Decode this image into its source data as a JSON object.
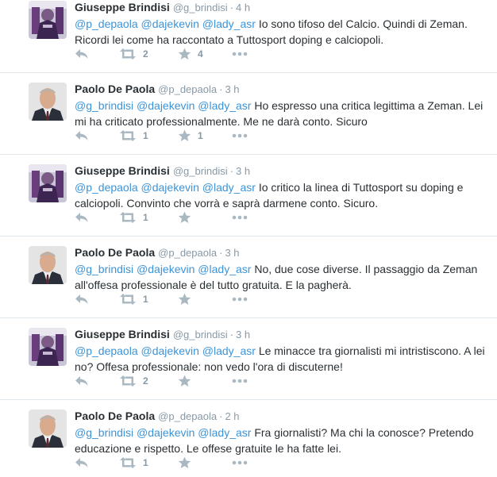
{
  "colors": {
    "mention": "#3b94d9",
    "meta": "#8899a6",
    "text": "#292f33",
    "divider": "#e1e8ed"
  },
  "icons": {
    "reply": "reply-icon",
    "retweet": "retweet-icon",
    "favorite": "star-icon",
    "more": "more-dots-icon"
  },
  "tweets": [
    {
      "author": "Giuseppe Brindisi",
      "handle": "@g_brindisi",
      "sep": "·",
      "time": "4 h",
      "mentions": [
        "@p_depaola",
        "@dajekevin",
        "@lady_asr"
      ],
      "text": "Io sono tifoso del Calcio. Quindi di Zeman. Ricordi lei come ha raccontato a Tuttosport doping e calciopoli.",
      "retweets": "2",
      "favorites": "4"
    },
    {
      "author": "Paolo De Paola",
      "handle": "@p_depaola",
      "sep": "·",
      "time": "3 h",
      "mentions": [
        "@g_brindisi",
        "@dajekevin",
        "@lady_asr"
      ],
      "text": "Ho espresso una critica legittima a Zeman. Lei mi ha criticato professionalmente. Me ne darà conto. Sicuro",
      "retweets": "1",
      "favorites": "1"
    },
    {
      "author": "Giuseppe Brindisi",
      "handle": "@g_brindisi",
      "sep": "·",
      "time": "3 h",
      "mentions": [
        "@p_depaola",
        "@dajekevin",
        "@lady_asr"
      ],
      "text": "Io critico la linea di Tuttosport su doping e calciopoli. Convinto che vorrà e saprà darmene conto. Sicuro.",
      "retweets": "1",
      "favorites": ""
    },
    {
      "author": "Paolo De Paola",
      "handle": "@p_depaola",
      "sep": "·",
      "time": "3 h",
      "mentions": [
        "@g_brindisi",
        "@dajekevin",
        "@lady_asr"
      ],
      "text": "No, due cose diverse. Il passaggio da Zeman all'offesa professionale è del tutto gratuita. E la pagherà.",
      "retweets": "1",
      "favorites": ""
    },
    {
      "author": "Giuseppe Brindisi",
      "handle": "@g_brindisi",
      "sep": "·",
      "time": "3 h",
      "mentions": [
        "@p_depaola",
        "@dajekevin",
        "@lady_asr"
      ],
      "text": "Le minacce tra giornalisti mi intristiscono. A lei no? Offesa professionale: non vedo l'ora di discuterne!",
      "retweets": "2",
      "favorites": ""
    },
    {
      "author": "Paolo De Paola",
      "handle": "@p_depaola",
      "sep": "·",
      "time": "2 h",
      "mentions": [
        "@g_brindisi",
        "@dajekevin",
        "@lady_asr"
      ],
      "text": "Fra giornalisti? Ma chi la conosce? Pretendo educazione e rispetto. Le offese gratuite le ha fatte lei.",
      "retweets": "1",
      "favorites": ""
    }
  ]
}
